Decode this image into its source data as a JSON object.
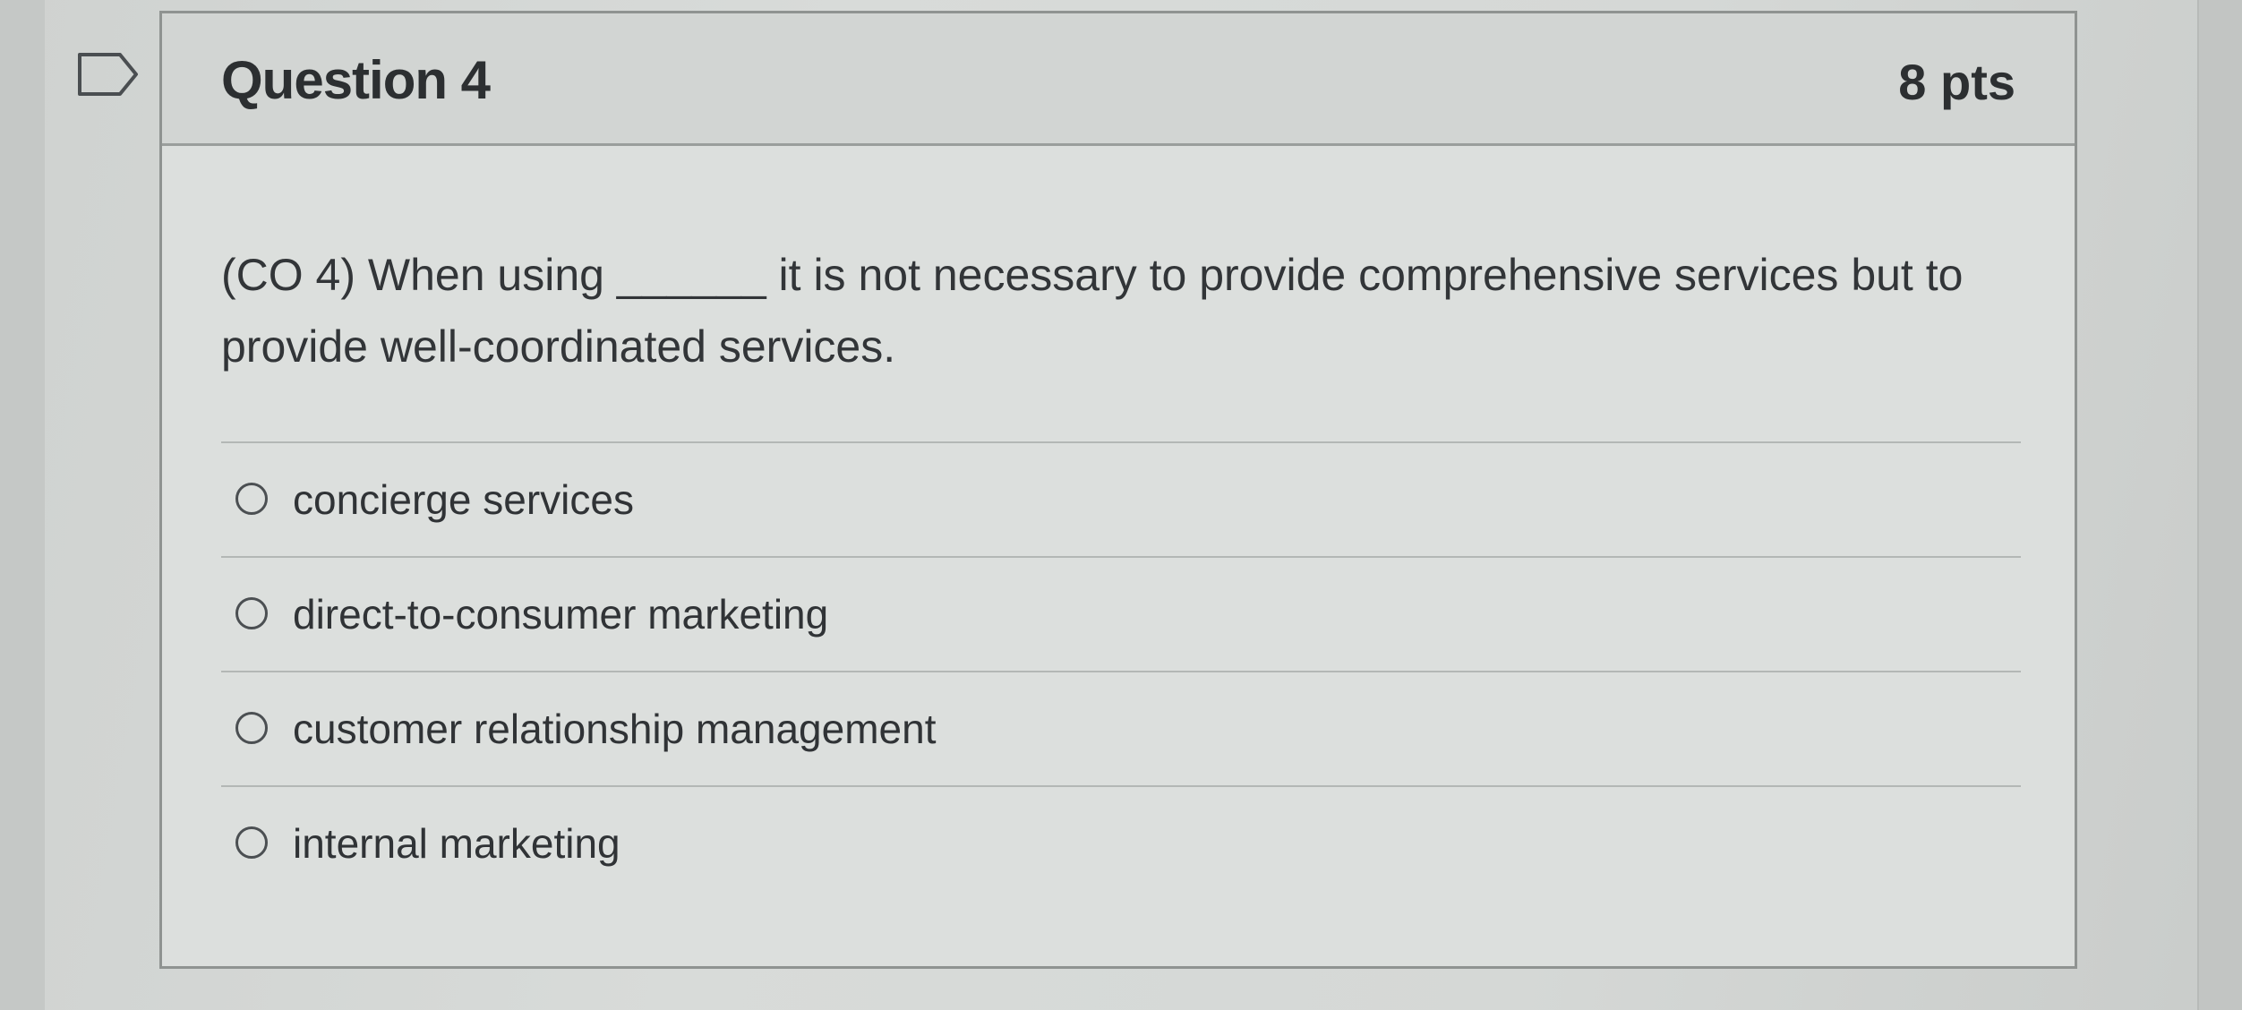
{
  "question": {
    "title": "Question 4",
    "points": "8 pts",
    "text": "(CO 4) When using ______ it is not necessary to provide comprehensive services but to provide well-coordinated services.",
    "answers": [
      "concierge services",
      "direct-to-consumer marketing",
      "customer relationship management",
      "internal marketing"
    ]
  },
  "icons": {
    "flag": "flag-icon"
  },
  "colors": {
    "card_border": "#8f9391",
    "text": "#2c2f31"
  }
}
